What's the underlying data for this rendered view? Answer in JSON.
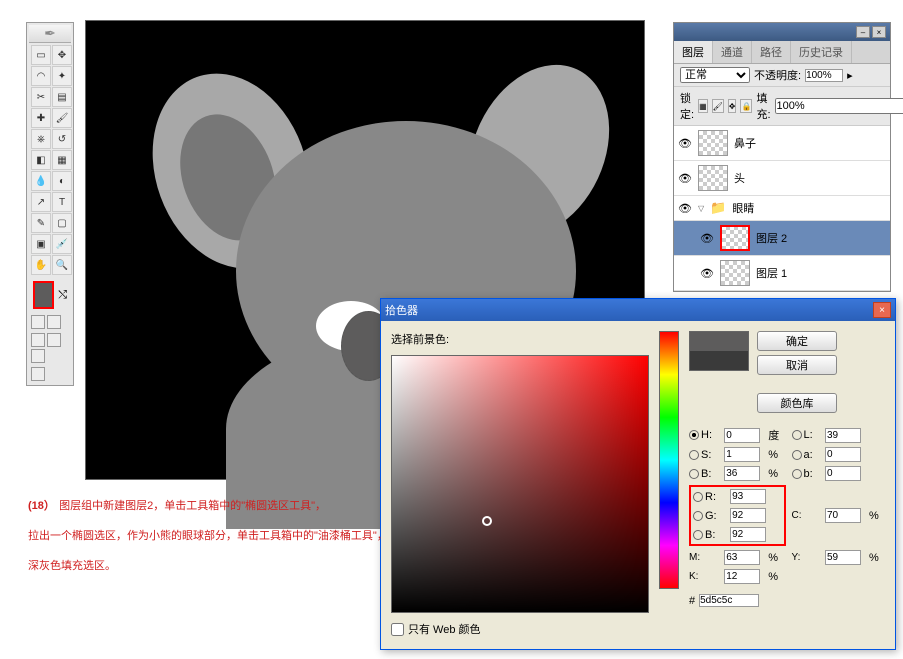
{
  "toolbox": {
    "header_icon": "feather"
  },
  "canvas": {
    "bg": "#000"
  },
  "layers": {
    "tabs": [
      "图层",
      "通道",
      "路径",
      "历史记录"
    ],
    "blend_mode": "正常",
    "opacity_label": "不透明度:",
    "opacity": "100%",
    "lock_label": "锁定:",
    "fill_label": "填充:",
    "fill": "100%",
    "items": [
      {
        "name": "鼻子",
        "eye": "👁"
      },
      {
        "name": "头",
        "eye": "👁"
      },
      {
        "name": "眼睛",
        "eye": "👁",
        "folder": true
      },
      {
        "name": "图层 2",
        "eye": "👁",
        "indent": true,
        "selected": true,
        "highlight": true
      },
      {
        "name": "图层 1",
        "eye": "👁",
        "indent": true
      }
    ]
  },
  "picker": {
    "title": "拾色器",
    "subtitle": "选择前景色:",
    "ok": "确定",
    "cancel": "取消",
    "library": "颜色库",
    "web_only": "只有 Web 颜色",
    "H": {
      "label": "H:",
      "val": "0",
      "unit": "度"
    },
    "S": {
      "label": "S:",
      "val": "1",
      "unit": "%"
    },
    "Bv": {
      "label": "B:",
      "val": "36",
      "unit": "%"
    },
    "R": {
      "label": "R:",
      "val": "93"
    },
    "G": {
      "label": "G:",
      "val": "92"
    },
    "Bb": {
      "label": "B:",
      "val": "92"
    },
    "L": {
      "label": "L:",
      "val": "39"
    },
    "a": {
      "label": "a:",
      "val": "0"
    },
    "b": {
      "label": "b:",
      "val": "0"
    },
    "C": {
      "label": "C:",
      "val": "70",
      "unit": "%"
    },
    "M": {
      "label": "M:",
      "val": "63",
      "unit": "%"
    },
    "Y": {
      "label": "Y:",
      "val": "59",
      "unit": "%"
    },
    "K": {
      "label": "K:",
      "val": "12",
      "unit": "%"
    },
    "hex_label": "#",
    "hex": "5d5c5c"
  },
  "instruction": {
    "step": "(18）",
    "line1": "图层组中新建图层2，单击工具箱中的\"椭圆选区工具\"，",
    "line2": "拉出一个椭圆选区，作为小熊的眼球部分，单击工具箱中的\"油漆桶工具\"，",
    "line3": "深灰色填充选区。"
  }
}
